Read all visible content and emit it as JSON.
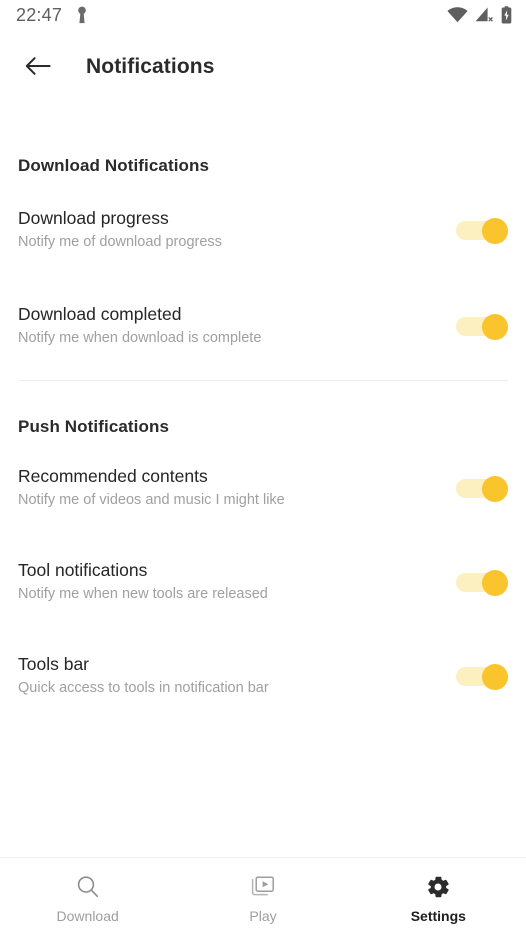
{
  "status_bar": {
    "time": "22:47",
    "left_icons": [
      "key-icon"
    ],
    "right_icons": [
      "wifi-icon",
      "cellular-signal-off-icon",
      "battery-charging-icon"
    ]
  },
  "app_bar": {
    "back_icon": "arrow-left-icon",
    "title": "Notifications"
  },
  "sections": [
    {
      "id": "download-notifications",
      "header": "Download Notifications",
      "rows": [
        {
          "title": "Download progress",
          "subtitle": "Notify me of download progress",
          "toggle_state": "on"
        },
        {
          "title": "Download completed",
          "subtitle": "Notify me when download is complete",
          "toggle_state": "on"
        }
      ]
    },
    {
      "id": "push-notifications",
      "header": "Push Notifications",
      "rows": [
        {
          "title": "Recommended contents",
          "subtitle": "Notify me of videos and music I might like",
          "toggle_state": "on"
        },
        {
          "title": "Tool notifications",
          "subtitle": "Notify me when new tools are released",
          "toggle_state": "on"
        },
        {
          "title": "Tools bar",
          "subtitle": "Quick access to tools in notification bar",
          "toggle_state": "on"
        }
      ]
    }
  ],
  "bottom_nav": {
    "items": [
      {
        "label": "Download",
        "icon": "search-icon",
        "active": false
      },
      {
        "label": "Play",
        "icon": "video-library-icon",
        "active": false
      },
      {
        "label": "Settings",
        "icon": "gear-icon",
        "active": true
      }
    ]
  },
  "colors": {
    "accent": "#f9c42c",
    "track": "#fcefc0",
    "title_text": "#262626",
    "subtitle_text": "#a0a0a0",
    "divider": "#eeeeee",
    "background": "#ffffff"
  }
}
